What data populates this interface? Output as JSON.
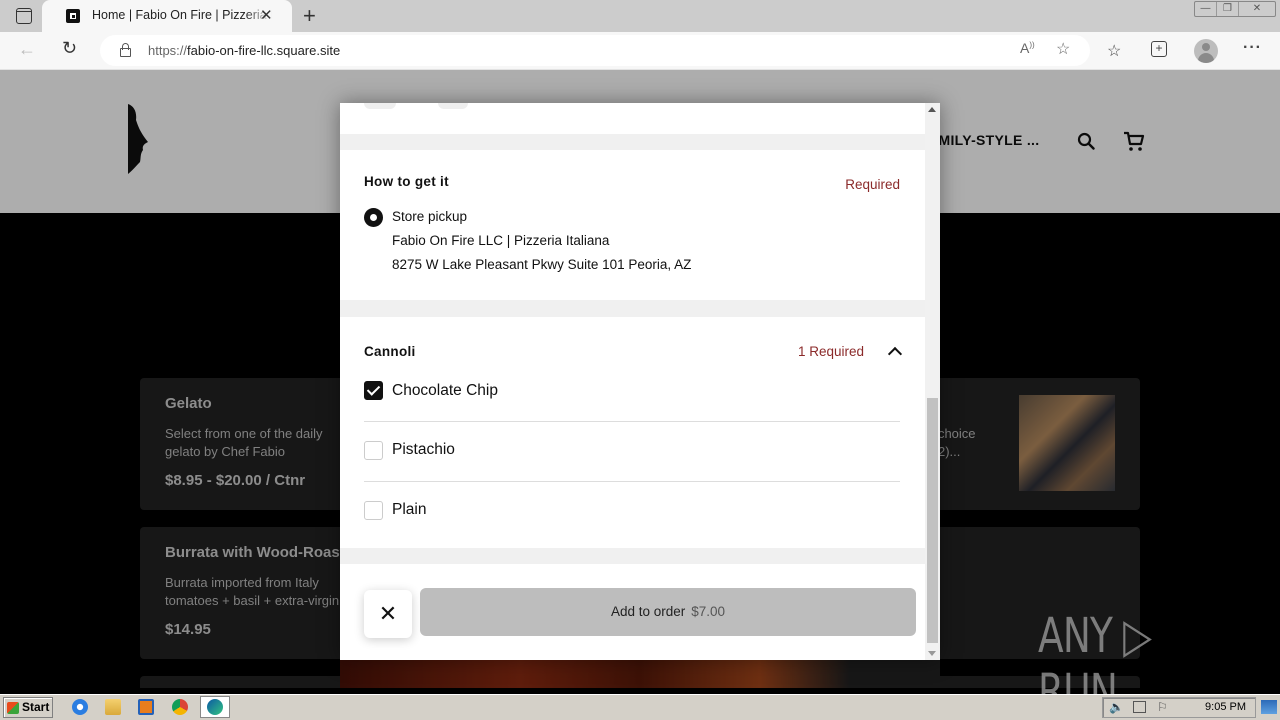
{
  "browser": {
    "tab_title": "Home | Fabio On Fire | Pizzeria Italiana",
    "tab_close": "✕",
    "new_tab": "+",
    "url_protocol": "https://",
    "url_host": "fabio-on-fire-llc.square.site",
    "window_buttons": [
      "—",
      "❐",
      "✕"
    ],
    "icons": [
      "read-aloud-icon",
      "add-favorite-icon",
      "favorites-icon",
      "collections-icon",
      "profile-icon",
      "more-icon"
    ]
  },
  "site": {
    "nav_text": "FAMILY-STYLE ...",
    "cards": [
      {
        "title": "Gelato",
        "desc_lines": [
          "Select from one of the daily",
          "gelato by Chef Fabio"
        ],
        "price": "$8.95 - $20.00 / Ctnr"
      },
      {
        "title": "Burrata with Wood-Roasted",
        "desc_lines": [
          "Burrata imported from Italy",
          "tomatoes + basil + extra-virgin"
        ],
        "price": "$14.95"
      },
      {
        "title": "",
        "desc_lines": [
          "r choice",
          "2)..."
        ],
        "price": ""
      }
    ]
  },
  "modal": {
    "pickup_section": {
      "title": "How to get it",
      "required": "Required",
      "option": "Store pickup",
      "store_name": "Fabio On Fire LLC | Pizzeria Italiana",
      "address": "8275 W Lake Pleasant Pkwy Suite 101 Peoria, AZ",
      "selected": true
    },
    "cannoli_section": {
      "title": "Cannoli",
      "required": "1 Required",
      "expanded": true,
      "options": [
        {
          "label": "Chocolate Chip",
          "checked": true
        },
        {
          "label": "Pistachio",
          "checked": false
        },
        {
          "label": "Plain",
          "checked": false
        }
      ]
    },
    "footer": {
      "close": "✕",
      "add_label": "Add to order",
      "add_price": "$7.00"
    }
  },
  "watermark": "ANY ▷ RUN",
  "taskbar": {
    "start": "Start",
    "apps": [
      "internet-explorer-icon",
      "file-explorer-icon",
      "media-player-icon",
      "chrome-icon",
      "edge-icon"
    ],
    "clock": "9:05 PM"
  }
}
